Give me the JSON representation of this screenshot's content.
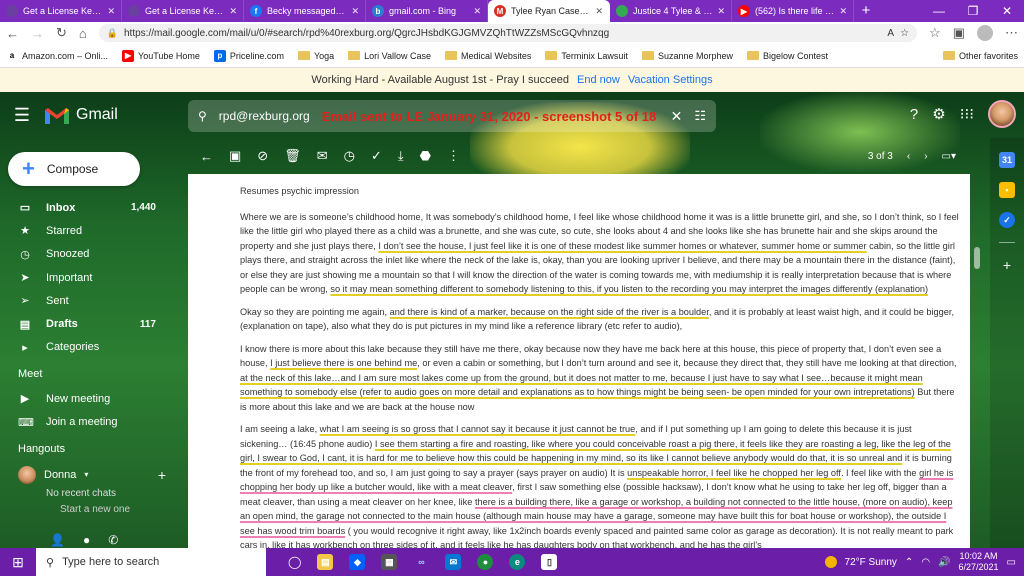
{
  "browser": {
    "tabs": [
      {
        "title": "Get a License Key - D",
        "icon_color": "#6a3fa0",
        "icon_glyph": ""
      },
      {
        "title": "Get a License Key - D",
        "icon_color": "#6a3fa0",
        "icon_glyph": ""
      },
      {
        "title": "Becky messaged your",
        "icon_color": "#1877f2",
        "icon_glyph": "f"
      },
      {
        "title": "gmail.com - Bing",
        "icon_color": "#2a7fd4",
        "icon_glyph": "b"
      },
      {
        "title": "Tylee Ryan Case - Lor",
        "icon_color": "#d93025",
        "icon_glyph": "M",
        "active": true
      },
      {
        "title": "Justice 4 Tylee & JJ - ",
        "icon_color": "#34a853",
        "icon_glyph": ""
      },
      {
        "title": "(562) Is there life after",
        "icon_color": "#ff0000",
        "icon_glyph": "▶"
      }
    ],
    "url": "https://mail.google.com/mail/u/0/#search/rpd%40rexburg.org/QgrcJHsbdKGJGMVZQhTtWZZsMScGQvhnzqg",
    "bookmarks": [
      {
        "label": "Amazon.com – Onli...",
        "icon": "amazon-icon"
      },
      {
        "label": "YouTube Home",
        "icon": "youtube-icon"
      },
      {
        "label": "Priceline.com",
        "icon": "priceline-icon"
      },
      {
        "label": "Yoga",
        "icon": "folder-icon"
      },
      {
        "label": "Lori Vallow Case",
        "icon": "folder-icon"
      },
      {
        "label": "Medical Websites",
        "icon": "folder-icon"
      },
      {
        "label": "Terminix Lawsuit",
        "icon": "folder-icon"
      },
      {
        "label": "Suzanne Morphew",
        "icon": "folder-icon"
      },
      {
        "label": "Bigelow Contest",
        "icon": "folder-icon"
      }
    ],
    "other_favorites": "Other favorites"
  },
  "vacation": {
    "message": "Working Hard - Available August 1st - Pray I succeed",
    "end_now": "End now",
    "settings": "Vacation Settings"
  },
  "gmail": {
    "logo_text": "Gmail",
    "search_query": "rpd@rexburg.org",
    "overlay_text": "Email sent to LE January 31, 2020 - screenshot 5 of 18",
    "compose": "Compose",
    "nav": [
      {
        "label": "Inbox",
        "count": "1,440",
        "bold": true,
        "icon": "inbox-icon",
        "glyph": "▭"
      },
      {
        "label": "Starred",
        "count": "",
        "bold": false,
        "icon": "star-icon",
        "glyph": "★"
      },
      {
        "label": "Snoozed",
        "count": "",
        "bold": false,
        "icon": "clock-icon",
        "glyph": "◷"
      },
      {
        "label": "Important",
        "count": "",
        "bold": false,
        "icon": "important-icon",
        "glyph": "➤"
      },
      {
        "label": "Sent",
        "count": "",
        "bold": false,
        "icon": "send-icon",
        "glyph": "➢"
      },
      {
        "label": "Drafts",
        "count": "117",
        "bold": true,
        "icon": "draft-icon",
        "glyph": "▤"
      },
      {
        "label": "Categories",
        "count": "",
        "bold": false,
        "icon": "label-icon",
        "glyph": "▸"
      }
    ],
    "meet": {
      "heading": "Meet",
      "new_meeting": "New meeting",
      "join_meeting": "Join a meeting"
    },
    "hangouts": {
      "heading": "Hangouts",
      "contact": "Donna",
      "no_recent": "No recent chats",
      "start_new": "Start a new one"
    },
    "pager": "3 of 3"
  },
  "email": {
    "heading": "Resumes psychic impression",
    "paragraphs": [
      [
        {
          "t": "Where we are is someone’s childhood home,  It was somebody’s childhood home, I feel like whose childhood home it was is a little brunette girl, and she, so I don’t think, so I feel like the little girl who played there as a child was a brunette, and she was cute, so cute, she looks about 4 and she looks like she has brunette hair and she skips around the property and she just plays there, "
        },
        {
          "t": "I don’t see the house, I just feel like it is one of these modest like summer homes or whatever, summer home or summer",
          "u": "y"
        },
        {
          "t": " cabin, so the little girl plays there, and straight across the inlet like where the neck of the lake is, okay, than you are looking upriver I believe, and there may be a mountain there in the distance (faint), or else they are just showing me a mountain so that I will know the direction of the water is coming towards me, with mediumship it is really interpretation because that is where people can be wrong, "
        },
        {
          "t": "so it may mean something different to somebody listening to this, if you listen to the recording you may interpret the images differently (explanation)",
          "u": "y"
        }
      ],
      [
        {
          "t": "Okay so they are pointing me again, "
        },
        {
          "t": "and there is kind of a marker, because on the right side of the river is a boulder",
          "u": "y"
        },
        {
          "t": ", and it is probably at least waist high, and it could be bigger, (explanation on tape), also what they do is put pictures in my mind like a reference library (etc refer to audio),"
        }
      ],
      [
        {
          "t": "I know there is more about this lake because they still have me there, okay because now they have me back here at this house, this piece of property that, I don’t even see a house, "
        },
        {
          "t": "I just believe there is one behind me",
          "u": "y"
        },
        {
          "t": ", or even a cabin or something, but I don’t turn around and see it, because they direct that, they still have me looking at that direction, "
        },
        {
          "t": "at the neck of this lake…and I am sure most lakes come up from the ground, but it does not matter to me, because I just have to say what I see…because it might mean something to somebody else (refer to audio goes on more detail and explanations as to how things might be being seen- be open minded for your own intrepretations)",
          "u": "y"
        },
        {
          "t": "  But there is more about this lake and we are back at the house now"
        }
      ],
      [
        {
          "t": "I am seeing a lake, "
        },
        {
          "t": "what I am seeing is so gross that I cannot say it because it just cannot be true",
          "u": "y"
        },
        {
          "t": ", and if I put something up I am going to delete this because it is just sickening… (16:45 phone audio) "
        },
        {
          "t": "I see them starting a fire and roasting, like where you could conceivable roast a pig there, it feels like they are roasting a leg, like the leg of the girl, I swear to God, I cant, it is hard for me to believe how this could be happening in my mind, so its like I cannot believe anybody would do that, it is so unreal and",
          "u": "y"
        },
        {
          "t": " it is burning the front of my forehead too, and so, I am just going to say a prayer (says prayer on audio) It is "
        },
        {
          "t": "unspeakable horror, I feel like he chopped her leg off",
          "u": "y"
        },
        {
          "t": ".  I feel like with the "
        },
        {
          "t": "girl he is chopping her body up like a butcher would, like with a meat cleaver",
          "u": "p"
        },
        {
          "t": ", first I saw something else (possible hacksaw), I don’t know what he using to take her leg off, bigger than a meat cleaver, than using a meat cleaver on her knee, like "
        },
        {
          "t": "there is a building there, like a garage or workshop, a building not connected to the little house, (more on audio), keep an open mind, the garage not connected to the main house (although main house may have a garage, someone may have built this for boat house or workshop), the outside I see has wood trim boards",
          "u": "p"
        },
        {
          "t": " ( you would recognive it right away, like 1x2inch boards evenly spaced and painted same color as garage as decoration). It is not really meant to park cars in, like it has workbench on three sides of it, and it feels like he has daughters body on that workbench,  and he has the girl’s"
        }
      ]
    ]
  },
  "taskbar": {
    "search_placeholder": "Type here to search",
    "weather": "72°F  Sunny",
    "time": "10:02 AM",
    "date": "6/27/2021"
  }
}
